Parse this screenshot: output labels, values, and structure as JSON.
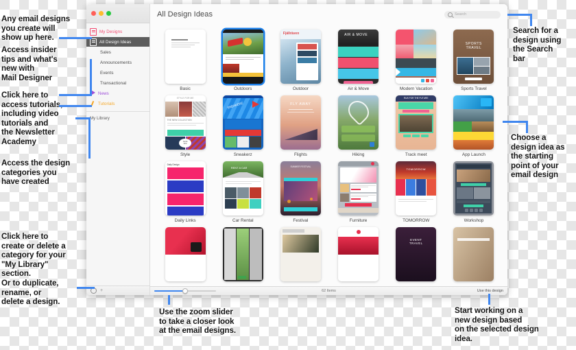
{
  "window": {
    "traffic_lights": [
      "close",
      "minimize",
      "zoom"
    ]
  },
  "sidebar": {
    "items": [
      {
        "label": "My Designs",
        "icon": "document-pink-icon",
        "level": "top",
        "color": "pink",
        "selected": false
      },
      {
        "label": "All Design Ideas",
        "icon": "document-icon",
        "level": "top",
        "color": "white",
        "selected": true
      },
      {
        "label": "Sales",
        "icon": "none",
        "level": "child",
        "color": "gray",
        "selected": false
      },
      {
        "label": "Announcements",
        "icon": "none",
        "level": "child",
        "color": "gray",
        "selected": false
      },
      {
        "label": "Events",
        "icon": "none",
        "level": "child",
        "color": "gray",
        "selected": false
      },
      {
        "label": "Transactional",
        "icon": "none",
        "level": "child",
        "color": "gray",
        "selected": false
      },
      {
        "label": "News",
        "icon": "megaphone-icon",
        "level": "top",
        "color": "purple",
        "selected": false
      },
      {
        "label": "Tutorials",
        "icon": "pencil-icon",
        "level": "top",
        "color": "orange",
        "selected": false
      }
    ],
    "library_label": "My Library",
    "footer": {
      "gear_icon": "gear-icon",
      "add_icon": "plus-icon"
    }
  },
  "content": {
    "title": "All Design Ideas",
    "search": {
      "placeholder": "Search",
      "icon": "search-icon",
      "value": ""
    },
    "designs": [
      {
        "label": "Basic",
        "selected": false,
        "style": "basic"
      },
      {
        "label": "Outdoors",
        "selected": true,
        "style": "outdoors"
      },
      {
        "label": "Outdoor",
        "selected": false,
        "style": "outdoor"
      },
      {
        "label": "Air & Move",
        "selected": false,
        "style": "airmove"
      },
      {
        "label": "Modern Vacation",
        "selected": false,
        "style": "modernvacation"
      },
      {
        "label": "Sports Travel",
        "selected": false,
        "style": "sportstravel"
      },
      {
        "label": "Style",
        "selected": false,
        "style": "style"
      },
      {
        "label": "Sneakerz",
        "selected": false,
        "style": "sneakerz"
      },
      {
        "label": "Flights",
        "selected": false,
        "style": "flights"
      },
      {
        "label": "Hiking",
        "selected": false,
        "style": "hiking"
      },
      {
        "label": "Track meet",
        "selected": false,
        "style": "trackmeet"
      },
      {
        "label": "App Launch",
        "selected": false,
        "style": "applaunch"
      },
      {
        "label": "Daily Links",
        "selected": false,
        "style": "dailylinks"
      },
      {
        "label": "Car Rental",
        "selected": false,
        "style": "carrental"
      },
      {
        "label": "Festival",
        "selected": false,
        "style": "festival"
      },
      {
        "label": "Furniture",
        "selected": false,
        "style": "furniture"
      },
      {
        "label": "TOMORROW",
        "selected": false,
        "style": "tomorrow"
      },
      {
        "label": "Workshop",
        "selected": false,
        "style": "workshop"
      },
      {
        "label": "",
        "selected": false,
        "style": "row4a"
      },
      {
        "label": "",
        "selected": false,
        "style": "row4b"
      },
      {
        "label": "",
        "selected": false,
        "style": "row4c"
      },
      {
        "label": "",
        "selected": false,
        "style": "row4d"
      },
      {
        "label": "",
        "selected": false,
        "style": "row4e"
      },
      {
        "label": "",
        "selected": false,
        "style": "row4f"
      }
    ]
  },
  "statusbar": {
    "zoom_slider_label": "zoom-slider",
    "item_count": "62 Items",
    "use_button": "Use this design"
  },
  "annotations": [
    {
      "id": "my-designs",
      "text": "Any email designs\nyou create will\nshow up here."
    },
    {
      "id": "news",
      "text": "Access insider\ntips and what's\nnew with\nMail Designer"
    },
    {
      "id": "tutorials",
      "text": "Click here to\naccess tutorials,\nincluding video\ntutorials and\nthe Newsletter\nAcademy"
    },
    {
      "id": "library",
      "text": "Access the design\ncategories you\nhave created"
    },
    {
      "id": "category-actions",
      "text": "Click here to\ncreate or delete a\ncategory for your\n\"My Library\"\nsection.\nOr to duplicate,\nrename, or\ndelete a design."
    },
    {
      "id": "search",
      "text": "Search for a\ndesign using\nthe Search\nbar"
    },
    {
      "id": "choose-idea",
      "text": "Choose a\ndesign idea as\nthe starting\npoint of your\nemail design"
    },
    {
      "id": "zoom-slider",
      "text": "Use the zoom slider\nto take a closer look\nat the email designs."
    },
    {
      "id": "use-design",
      "text": "Start working on a\nnew design based\non the selected design\nidea."
    }
  ],
  "colors": {
    "accent": "#3f86ef",
    "selection": "#1a7fea",
    "sidebar_selected": "#5c5c5c",
    "pink": "#f3486f",
    "purple": "#9b4bd8",
    "orange": "#f5a623"
  }
}
